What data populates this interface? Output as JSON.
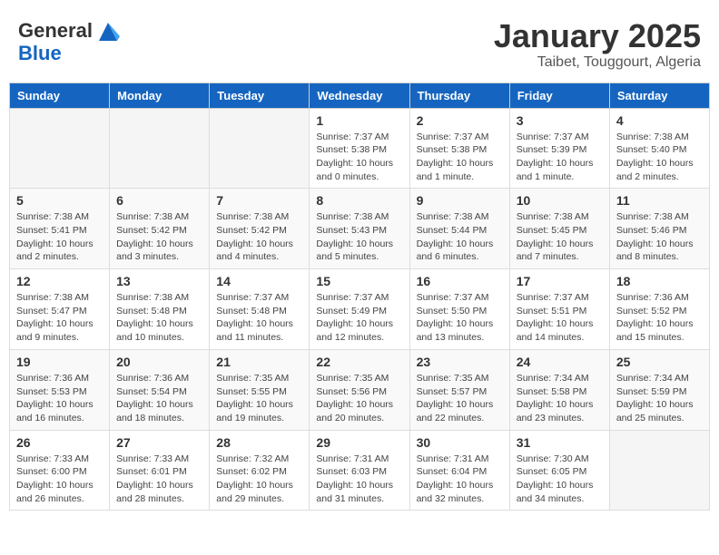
{
  "header": {
    "logo_line1": "General",
    "logo_line2": "Blue",
    "month_title": "January 2025",
    "subtitle": "Taibet, Touggourt, Algeria"
  },
  "weekdays": [
    "Sunday",
    "Monday",
    "Tuesday",
    "Wednesday",
    "Thursday",
    "Friday",
    "Saturday"
  ],
  "weeks": [
    [
      {
        "day": "",
        "sunrise": "",
        "sunset": "",
        "daylight": ""
      },
      {
        "day": "",
        "sunrise": "",
        "sunset": "",
        "daylight": ""
      },
      {
        "day": "",
        "sunrise": "",
        "sunset": "",
        "daylight": ""
      },
      {
        "day": "1",
        "sunrise": "Sunrise: 7:37 AM",
        "sunset": "Sunset: 5:38 PM",
        "daylight": "Daylight: 10 hours and 0 minutes."
      },
      {
        "day": "2",
        "sunrise": "Sunrise: 7:37 AM",
        "sunset": "Sunset: 5:38 PM",
        "daylight": "Daylight: 10 hours and 1 minute."
      },
      {
        "day": "3",
        "sunrise": "Sunrise: 7:37 AM",
        "sunset": "Sunset: 5:39 PM",
        "daylight": "Daylight: 10 hours and 1 minute."
      },
      {
        "day": "4",
        "sunrise": "Sunrise: 7:38 AM",
        "sunset": "Sunset: 5:40 PM",
        "daylight": "Daylight: 10 hours and 2 minutes."
      }
    ],
    [
      {
        "day": "5",
        "sunrise": "Sunrise: 7:38 AM",
        "sunset": "Sunset: 5:41 PM",
        "daylight": "Daylight: 10 hours and 2 minutes."
      },
      {
        "day": "6",
        "sunrise": "Sunrise: 7:38 AM",
        "sunset": "Sunset: 5:42 PM",
        "daylight": "Daylight: 10 hours and 3 minutes."
      },
      {
        "day": "7",
        "sunrise": "Sunrise: 7:38 AM",
        "sunset": "Sunset: 5:42 PM",
        "daylight": "Daylight: 10 hours and 4 minutes."
      },
      {
        "day": "8",
        "sunrise": "Sunrise: 7:38 AM",
        "sunset": "Sunset: 5:43 PM",
        "daylight": "Daylight: 10 hours and 5 minutes."
      },
      {
        "day": "9",
        "sunrise": "Sunrise: 7:38 AM",
        "sunset": "Sunset: 5:44 PM",
        "daylight": "Daylight: 10 hours and 6 minutes."
      },
      {
        "day": "10",
        "sunrise": "Sunrise: 7:38 AM",
        "sunset": "Sunset: 5:45 PM",
        "daylight": "Daylight: 10 hours and 7 minutes."
      },
      {
        "day": "11",
        "sunrise": "Sunrise: 7:38 AM",
        "sunset": "Sunset: 5:46 PM",
        "daylight": "Daylight: 10 hours and 8 minutes."
      }
    ],
    [
      {
        "day": "12",
        "sunrise": "Sunrise: 7:38 AM",
        "sunset": "Sunset: 5:47 PM",
        "daylight": "Daylight: 10 hours and 9 minutes."
      },
      {
        "day": "13",
        "sunrise": "Sunrise: 7:38 AM",
        "sunset": "Sunset: 5:48 PM",
        "daylight": "Daylight: 10 hours and 10 minutes."
      },
      {
        "day": "14",
        "sunrise": "Sunrise: 7:37 AM",
        "sunset": "Sunset: 5:48 PM",
        "daylight": "Daylight: 10 hours and 11 minutes."
      },
      {
        "day": "15",
        "sunrise": "Sunrise: 7:37 AM",
        "sunset": "Sunset: 5:49 PM",
        "daylight": "Daylight: 10 hours and 12 minutes."
      },
      {
        "day": "16",
        "sunrise": "Sunrise: 7:37 AM",
        "sunset": "Sunset: 5:50 PM",
        "daylight": "Daylight: 10 hours and 13 minutes."
      },
      {
        "day": "17",
        "sunrise": "Sunrise: 7:37 AM",
        "sunset": "Sunset: 5:51 PM",
        "daylight": "Daylight: 10 hours and 14 minutes."
      },
      {
        "day": "18",
        "sunrise": "Sunrise: 7:36 AM",
        "sunset": "Sunset: 5:52 PM",
        "daylight": "Daylight: 10 hours and 15 minutes."
      }
    ],
    [
      {
        "day": "19",
        "sunrise": "Sunrise: 7:36 AM",
        "sunset": "Sunset: 5:53 PM",
        "daylight": "Daylight: 10 hours and 16 minutes."
      },
      {
        "day": "20",
        "sunrise": "Sunrise: 7:36 AM",
        "sunset": "Sunset: 5:54 PM",
        "daylight": "Daylight: 10 hours and 18 minutes."
      },
      {
        "day": "21",
        "sunrise": "Sunrise: 7:35 AM",
        "sunset": "Sunset: 5:55 PM",
        "daylight": "Daylight: 10 hours and 19 minutes."
      },
      {
        "day": "22",
        "sunrise": "Sunrise: 7:35 AM",
        "sunset": "Sunset: 5:56 PM",
        "daylight": "Daylight: 10 hours and 20 minutes."
      },
      {
        "day": "23",
        "sunrise": "Sunrise: 7:35 AM",
        "sunset": "Sunset: 5:57 PM",
        "daylight": "Daylight: 10 hours and 22 minutes."
      },
      {
        "day": "24",
        "sunrise": "Sunrise: 7:34 AM",
        "sunset": "Sunset: 5:58 PM",
        "daylight": "Daylight: 10 hours and 23 minutes."
      },
      {
        "day": "25",
        "sunrise": "Sunrise: 7:34 AM",
        "sunset": "Sunset: 5:59 PM",
        "daylight": "Daylight: 10 hours and 25 minutes."
      }
    ],
    [
      {
        "day": "26",
        "sunrise": "Sunrise: 7:33 AM",
        "sunset": "Sunset: 6:00 PM",
        "daylight": "Daylight: 10 hours and 26 minutes."
      },
      {
        "day": "27",
        "sunrise": "Sunrise: 7:33 AM",
        "sunset": "Sunset: 6:01 PM",
        "daylight": "Daylight: 10 hours and 28 minutes."
      },
      {
        "day": "28",
        "sunrise": "Sunrise: 7:32 AM",
        "sunset": "Sunset: 6:02 PM",
        "daylight": "Daylight: 10 hours and 29 minutes."
      },
      {
        "day": "29",
        "sunrise": "Sunrise: 7:31 AM",
        "sunset": "Sunset: 6:03 PM",
        "daylight": "Daylight: 10 hours and 31 minutes."
      },
      {
        "day": "30",
        "sunrise": "Sunrise: 7:31 AM",
        "sunset": "Sunset: 6:04 PM",
        "daylight": "Daylight: 10 hours and 32 minutes."
      },
      {
        "day": "31",
        "sunrise": "Sunrise: 7:30 AM",
        "sunset": "Sunset: 6:05 PM",
        "daylight": "Daylight: 10 hours and 34 minutes."
      },
      {
        "day": "",
        "sunrise": "",
        "sunset": "",
        "daylight": ""
      }
    ]
  ]
}
